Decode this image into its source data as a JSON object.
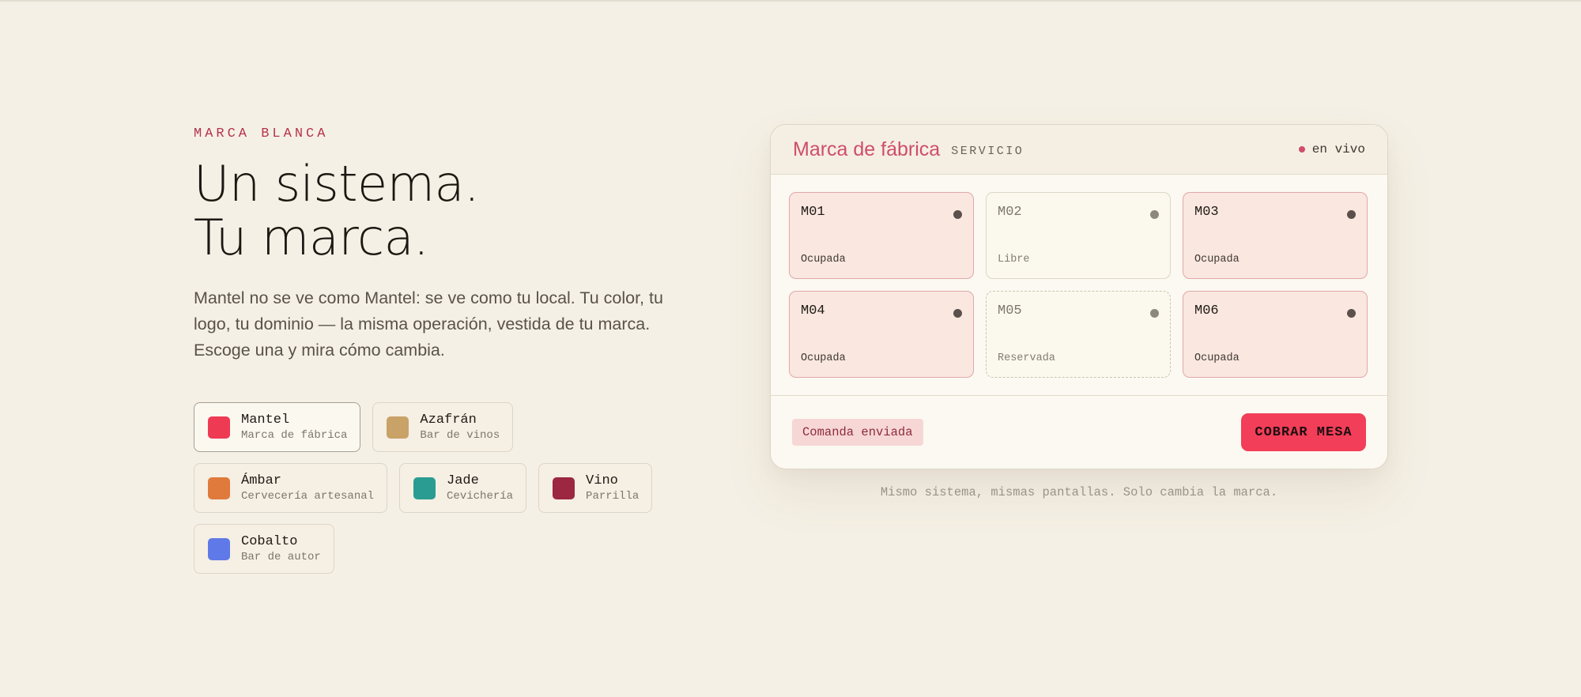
{
  "hero": {
    "eyebrow": "MARCA BLANCA",
    "headline_line1": "Un sistema.",
    "headline_line2": "Tu marca.",
    "lede": "Mantel no se ve como Mantel: se ve como tu local. Tu color, tu logo, tu dominio — la misma operación, vestida de tu marca. Escoge una y mira cómo cambia."
  },
  "brands": [
    {
      "name": "Mantel",
      "sub": "Marca de fábrica",
      "color": "#ef3a53",
      "selected": true
    },
    {
      "name": "Azafrán",
      "sub": "Bar de vinos",
      "color": "#c9a267"
    },
    {
      "name": "Ámbar",
      "sub": "Cervecería artesanal",
      "color": "#e07a3c"
    },
    {
      "name": "Jade",
      "sub": "Cevichería",
      "color": "#2a9c92"
    },
    {
      "name": "Vino",
      "sub": "Parrilla",
      "color": "#9b2840"
    },
    {
      "name": "Cobalto",
      "sub": "Bar de autor",
      "color": "#5f7ae8"
    }
  ],
  "preview": {
    "brand_title": "Marca de fábrica",
    "section": "SERVICIO",
    "live_label": "en vivo",
    "tables": [
      {
        "id": "M01",
        "status": "Ocupada"
      },
      {
        "id": "M02",
        "status": "Libre"
      },
      {
        "id": "M03",
        "status": "Ocupada"
      },
      {
        "id": "M04",
        "status": "Ocupada"
      },
      {
        "id": "M05",
        "status": "Reservada"
      },
      {
        "id": "M06",
        "status": "Ocupada"
      }
    ],
    "order_pill": "Comanda enviada",
    "cta_label": "COBRAR MESA",
    "caption": "Mismo sistema, mismas pantallas. Solo cambia la marca."
  },
  "colors": {
    "accent": "#cf4e68",
    "cta": "#f23e58",
    "background": "#f5f0e5"
  }
}
